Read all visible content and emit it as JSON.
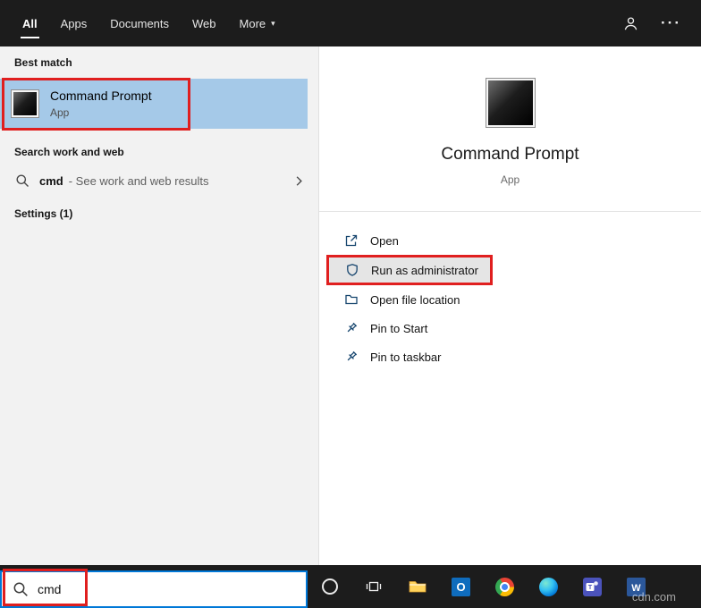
{
  "colors": {
    "accent_blue": "#0078d7",
    "highlight_blue": "#a5c9e8",
    "annotation_red": "#e01f1f",
    "topbar_bg": "#1c1c1c",
    "taskbar_bg": "#1c1c1c",
    "panel_bg": "#f2f2f2"
  },
  "header": {
    "tabs": [
      {
        "label": "All",
        "active": true
      },
      {
        "label": "Apps",
        "active": false
      },
      {
        "label": "Documents",
        "active": false
      },
      {
        "label": "Web",
        "active": false
      },
      {
        "label": "More",
        "active": false,
        "has_dropdown": true
      }
    ],
    "right_icons": [
      "account-icon",
      "ellipsis-icon"
    ]
  },
  "left_panel": {
    "sections": {
      "best_match_label": "Best match",
      "search_web_label": "Search work and web",
      "settings_label": "Settings (1)"
    },
    "best_match": {
      "title": "Command Prompt",
      "subtitle": "App",
      "icon": "command-prompt-icon"
    },
    "web_suggestion": {
      "query": "cmd",
      "description": "- See work and web results",
      "icon": "search-icon",
      "chevron": "chevron-right-icon"
    }
  },
  "preview_panel": {
    "app_title": "Command Prompt",
    "app_subtitle": "App",
    "icon": "command-prompt-icon",
    "actions": [
      {
        "label": "Open",
        "icon": "open-icon",
        "highlighted": false
      },
      {
        "label": "Run as administrator",
        "icon": "shield-icon",
        "highlighted": true
      },
      {
        "label": "Open file location",
        "icon": "folder-icon",
        "highlighted": false
      },
      {
        "label": "Pin to Start",
        "icon": "pin-icon",
        "highlighted": false
      },
      {
        "label": "Pin to taskbar",
        "icon": "pin-icon",
        "highlighted": false
      }
    ]
  },
  "taskbar": {
    "search": {
      "value": "cmd",
      "icon": "search-icon"
    },
    "icons": [
      "cortana-icon",
      "task-view-icon",
      "file-explorer-icon",
      "outlook-icon",
      "chrome-icon",
      "edge-icon",
      "teams-icon",
      "word-icon"
    ]
  },
  "watermark": "cdn.com"
}
